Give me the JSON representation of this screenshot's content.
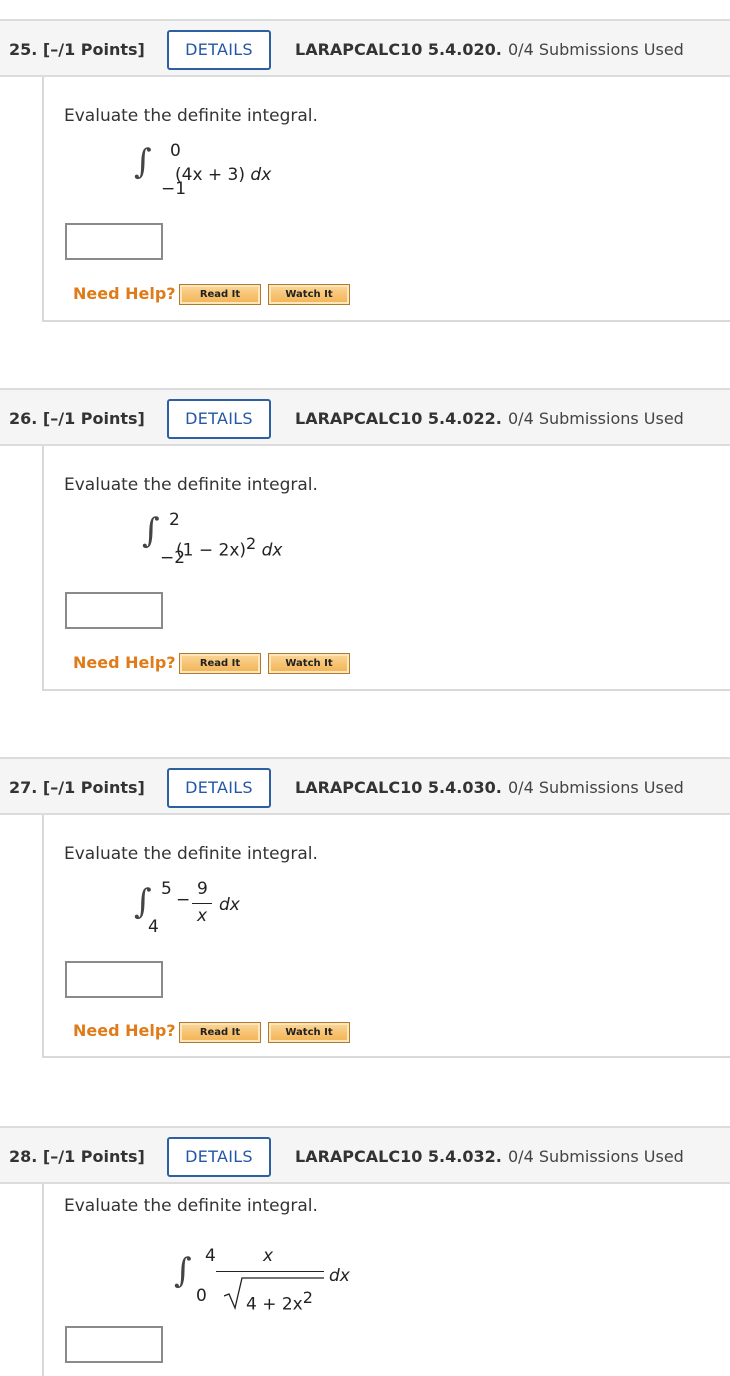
{
  "questions": [
    {
      "number": "25.",
      "points": "[–/1 Points]",
      "details_label": "DETAILS",
      "code": "LARAPCALC10 5.4.020.",
      "submissions": "0/4 Submissions Used",
      "prompt": "Evaluate the definite integral.",
      "integral": {
        "upper": "0",
        "lower": "−1",
        "integrand": "(4x + 3)",
        "dx": "dx"
      },
      "help_label": "Need Help?",
      "read_label": "Read It",
      "watch_label": "Watch It"
    },
    {
      "number": "26.",
      "points": "[–/1 Points]",
      "details_label": "DETAILS",
      "code": "LARAPCALC10 5.4.022.",
      "submissions": "0/4 Submissions Used",
      "prompt": "Evaluate the definite integral.",
      "integral": {
        "upper": "2",
        "lower": "−2",
        "integrand": "(1 − 2x)",
        "exponent": "2",
        "dx": "dx"
      },
      "help_label": "Need Help?",
      "read_label": "Read It",
      "watch_label": "Watch It"
    },
    {
      "number": "27.",
      "points": "[–/1 Points]",
      "details_label": "DETAILS",
      "code": "LARAPCALC10 5.4.030.",
      "submissions": "0/4 Submissions Used",
      "prompt": "Evaluate the definite integral.",
      "integral": {
        "upper": "5",
        "lower": "4",
        "sign": "−",
        "numerator": "9",
        "denominator": "x",
        "dx": "dx"
      },
      "help_label": "Need Help?",
      "read_label": "Read It",
      "watch_label": "Watch It"
    },
    {
      "number": "28.",
      "points": "[–/1 Points]",
      "details_label": "DETAILS",
      "code": "LARAPCALC10 5.4.032.",
      "submissions": "0/4 Submissions Used",
      "prompt": "Evaluate the definite integral.",
      "integral": {
        "upper": "4",
        "lower": "0",
        "numerator": "x",
        "radicand": "4 + 2x",
        "exponent": "2",
        "dx": "dx"
      }
    }
  ],
  "colors": {
    "details_border": "#2d5fa3",
    "help_text": "#e07b1a",
    "header_bg": "#f5f5f5"
  }
}
